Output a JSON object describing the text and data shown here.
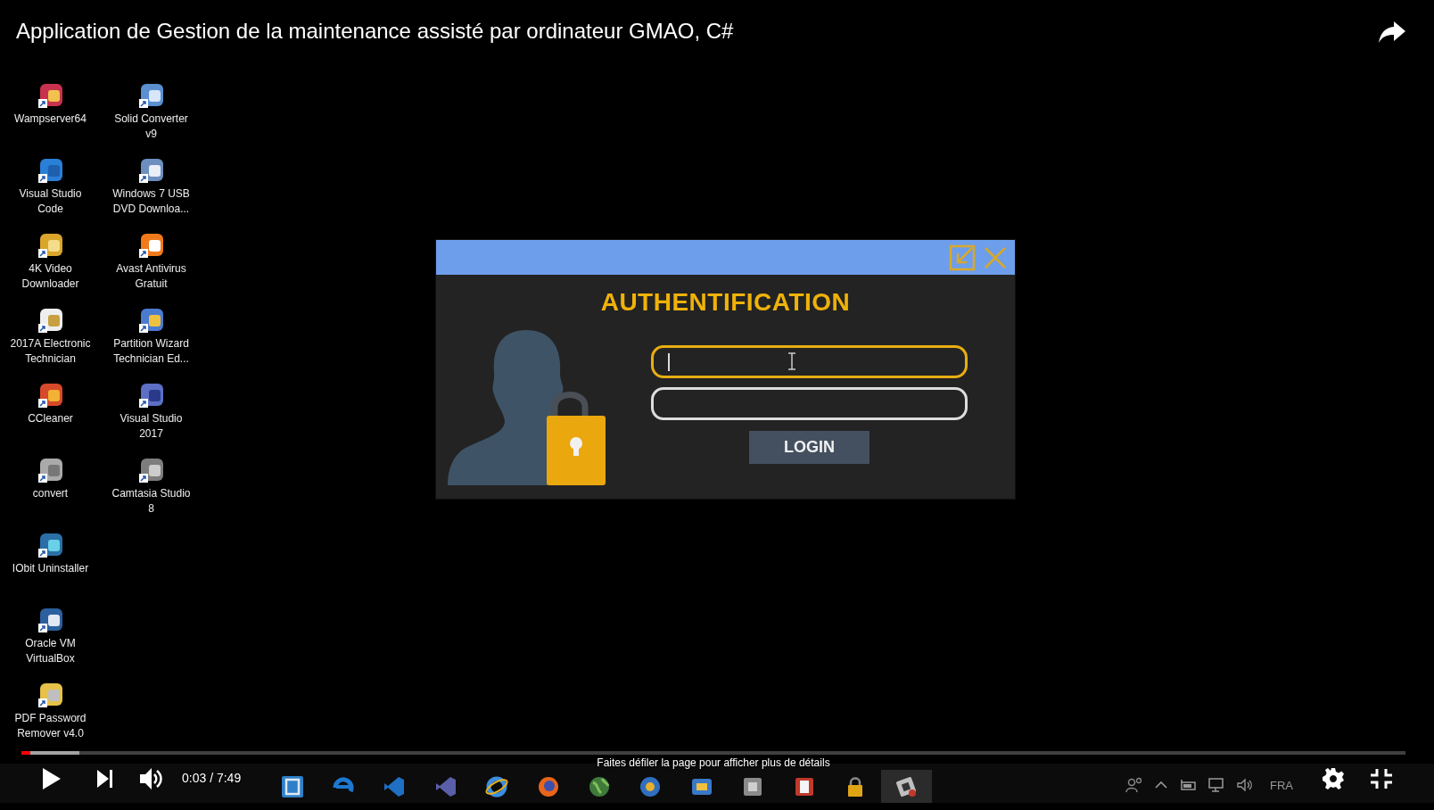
{
  "video": {
    "title": "Application de Gestion de la maintenance assisté par ordinateur GMAO, C#"
  },
  "desktop": {
    "icon_columns": [
      {
        "icons": [
          {
            "label": "Wampserver64"
          },
          {
            "label": "Visual Studio Code"
          },
          {
            "label": "4K Video Downloader"
          },
          {
            "label": "2017A Electronic Technician"
          },
          {
            "label": "CCleaner"
          },
          {
            "label": "convert"
          },
          {
            "label": "IObit Uninstaller"
          },
          {
            "label": "Oracle VM VirtualBox"
          },
          {
            "label": "PDF Password Remover v4.0"
          }
        ]
      },
      {
        "icons": [
          {
            "label": "Solid Converter v9"
          },
          {
            "label": "Windows 7 USB DVD Downloa..."
          },
          {
            "label": "Avast Antivirus Gratuit"
          },
          {
            "label": "Partition Wizard Technician Ed..."
          },
          {
            "label": "Visual Studio 2017"
          },
          {
            "label": "Camtasia Studio 8"
          }
        ]
      }
    ]
  },
  "login_dialog": {
    "heading": "AUTHENTIFICATION",
    "fields": [
      {
        "focused": true
      },
      {
        "focused": false
      }
    ],
    "button": "LOGIN"
  },
  "taskbar": {
    "apps": [
      {
        "selected": false
      },
      {
        "selected": false
      },
      {
        "selected": false
      },
      {
        "selected": false
      },
      {
        "selected": false
      },
      {
        "selected": false
      },
      {
        "selected": false
      },
      {
        "selected": false
      },
      {
        "selected": false
      },
      {
        "selected": false
      },
      {
        "selected": false
      },
      {
        "selected": false
      },
      {
        "selected": true
      }
    ],
    "language": "FRA"
  },
  "player": {
    "progress": {
      "level": 0.0066
    },
    "buffered": {
      "level": 0.042
    },
    "time": "0:03 / 7:49",
    "hint": "Faites défiler la page pour afficher plus de détails"
  }
}
